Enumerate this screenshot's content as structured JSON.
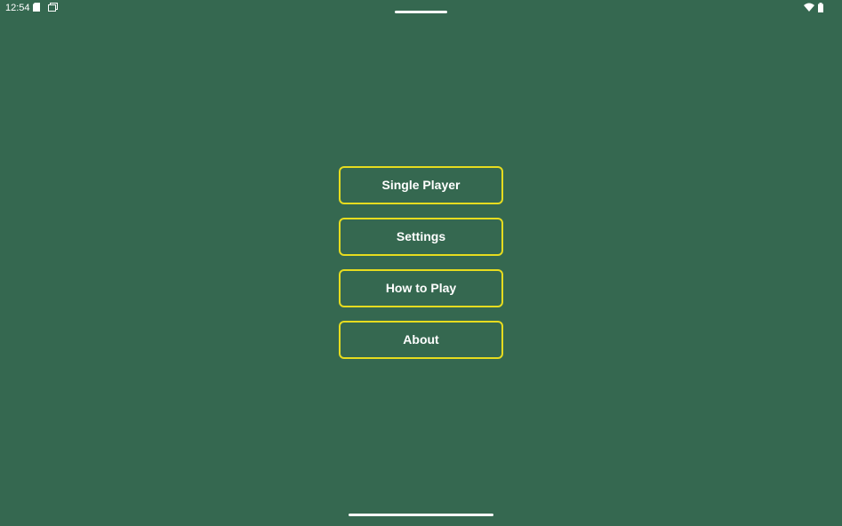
{
  "colors": {
    "background": "#356850",
    "button_border": "#e6dc1f",
    "text": "#ffffff"
  },
  "status_bar": {
    "time": "12:54",
    "left_icons": [
      "sd-card-icon",
      "screen-cast-icon"
    ],
    "right_icons": [
      "wifi-icon",
      "battery-icon"
    ]
  },
  "menu": {
    "items": [
      {
        "label": "Single Player"
      },
      {
        "label": "Settings"
      },
      {
        "label": "How to Play"
      },
      {
        "label": "About"
      }
    ]
  }
}
